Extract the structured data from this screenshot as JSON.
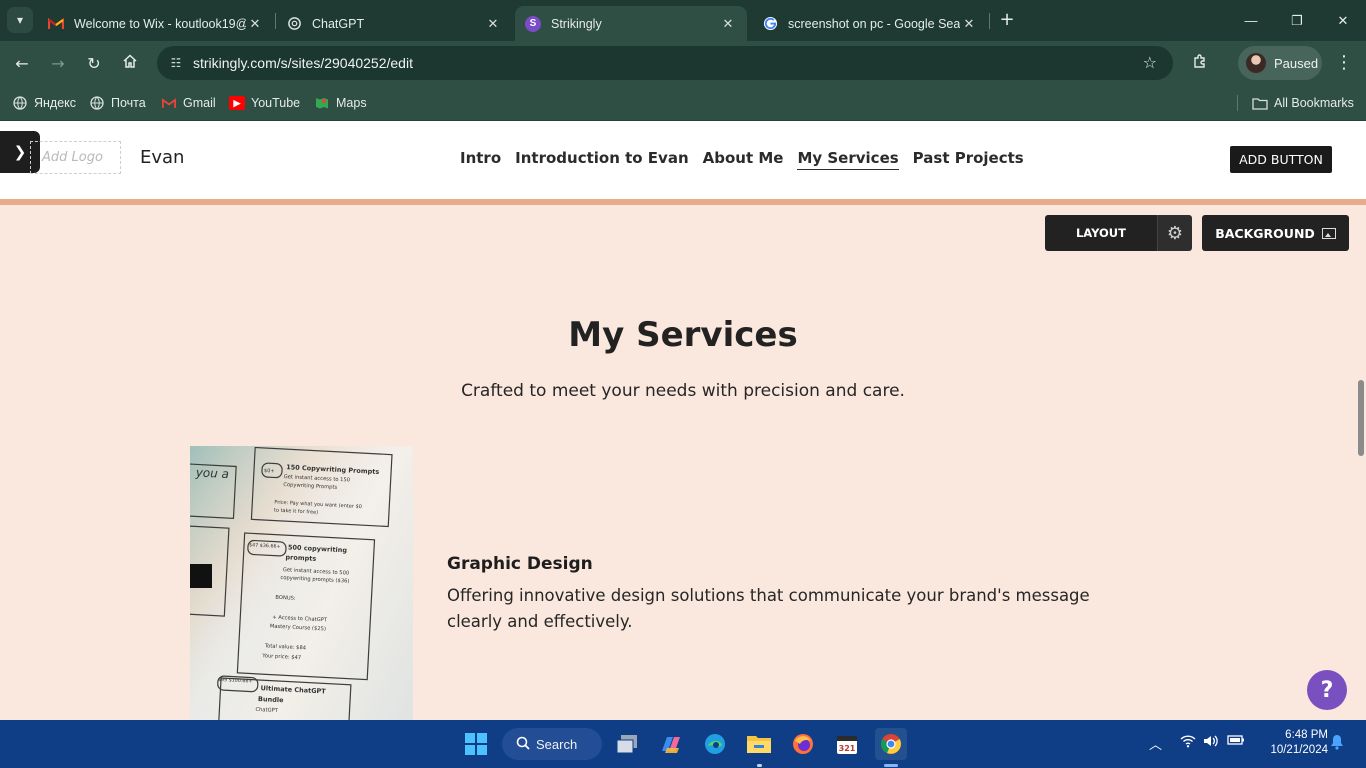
{
  "browser": {
    "tabs": [
      {
        "title": "Welcome to Wix - koutlook19@",
        "icon": "gmail-icon"
      },
      {
        "title": "ChatGPT",
        "icon": "chatgpt-icon"
      },
      {
        "title": "Strikingly",
        "icon": "strikingly-icon",
        "active": true
      },
      {
        "title": "screenshot on pc - Google Sear",
        "icon": "google-icon"
      }
    ],
    "url": "strikingly.com/s/sites/29040252/edit",
    "profile_label": "Paused",
    "bookmarks": [
      "Яндекс",
      "Почта",
      "Gmail",
      "YouTube",
      "Maps"
    ],
    "all_bookmarks_label": "All Bookmarks"
  },
  "site": {
    "add_logo_placeholder": "Add Logo",
    "name": "Evan",
    "nav": [
      "Intro",
      "Introduction to Evan",
      "About Me",
      "My Services",
      "Past Projects"
    ],
    "active_nav": "My Services",
    "add_button_label": "ADD BUTTON"
  },
  "editor": {
    "layout_label": "LAYOUT",
    "background_label": "BACKGROUND"
  },
  "section": {
    "title": "My Services",
    "subtitle": "Crafted to meet your needs with precision and care.",
    "service": {
      "title": "Graphic Design",
      "description": "Offering innovative design solutions that communicate your brand's message clearly and effectively."
    },
    "image_text": {
      "partial_word": "you a",
      "card1_badge": "$0+",
      "card1_title": "150 Copywriting Prompts",
      "card1_line1": "Get instant access to 150",
      "card1_line2": "Copywriting Prompts",
      "card1_price1": "Price: Pay what you want (enter $0",
      "card1_price2": "to take it for free)",
      "card2_badge": "$47 $36.66+",
      "card2_title1": "500 copywriting",
      "card2_title2": "prompts",
      "card2_line1": "Get instant access to 500",
      "card2_line2": "copywriting prompts ($36)",
      "card2_bonus": "BONUS:",
      "card2_bonus1": "+ Access to ChatGPT",
      "card2_bonus2": "Mastery Course ($25)",
      "card2_total": "Total value: $84",
      "card2_price": "Your price: $47",
      "card3_badge": "$99 $100.66+",
      "card3_title1": "Ultimate ChatGPT",
      "card3_title2": "Bundle",
      "card3_partial": "ChatGPT"
    }
  },
  "taskbar": {
    "search_label": "Search",
    "time": "6:48 PM",
    "date": "10/21/2024"
  },
  "colors": {
    "chrome_dark": "#1e3a32",
    "chrome_toolbar": "#2f4e44",
    "section_bg": "#fae7de",
    "header_accent": "#e8ac8b",
    "taskbar": "#0f3d86",
    "help_button": "#7a4fc0"
  }
}
